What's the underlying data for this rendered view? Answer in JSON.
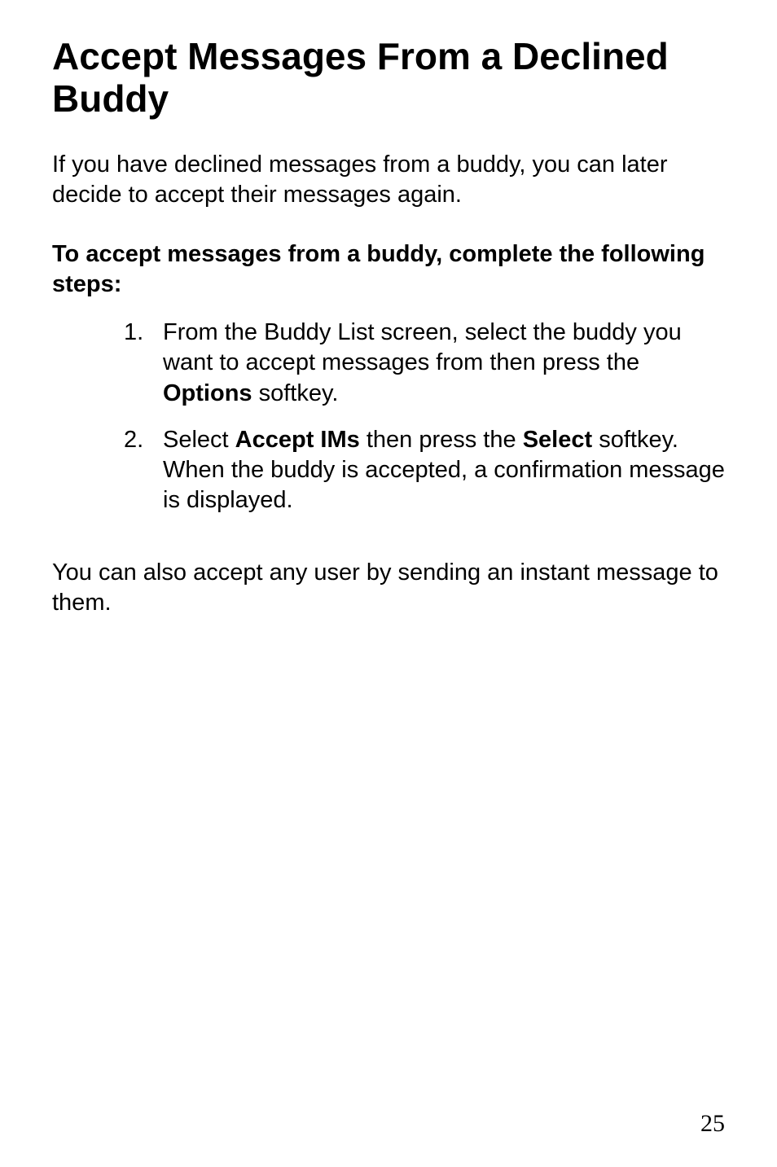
{
  "title": "Accept Messages From a Declined Buddy",
  "intro": "If you have declined messages from a buddy, you can later decide to accept their messages again.",
  "sub": "To accept messages from a buddy, complete the following steps:",
  "steps": [
    {
      "pre": "From the Buddy List screen, select the buddy you want to accept messages from then press the ",
      "bold1": "Options",
      "post1": " softkey."
    },
    {
      "pre": "Select ",
      "bold1": "Accept IMs",
      "mid": " then press the ",
      "bold2": "Select",
      "post2": " softkey. When the buddy is accepted, a confirmation message is displayed."
    }
  ],
  "outro": "You can also accept any user by sending an instant message to them.",
  "page_number": "25"
}
